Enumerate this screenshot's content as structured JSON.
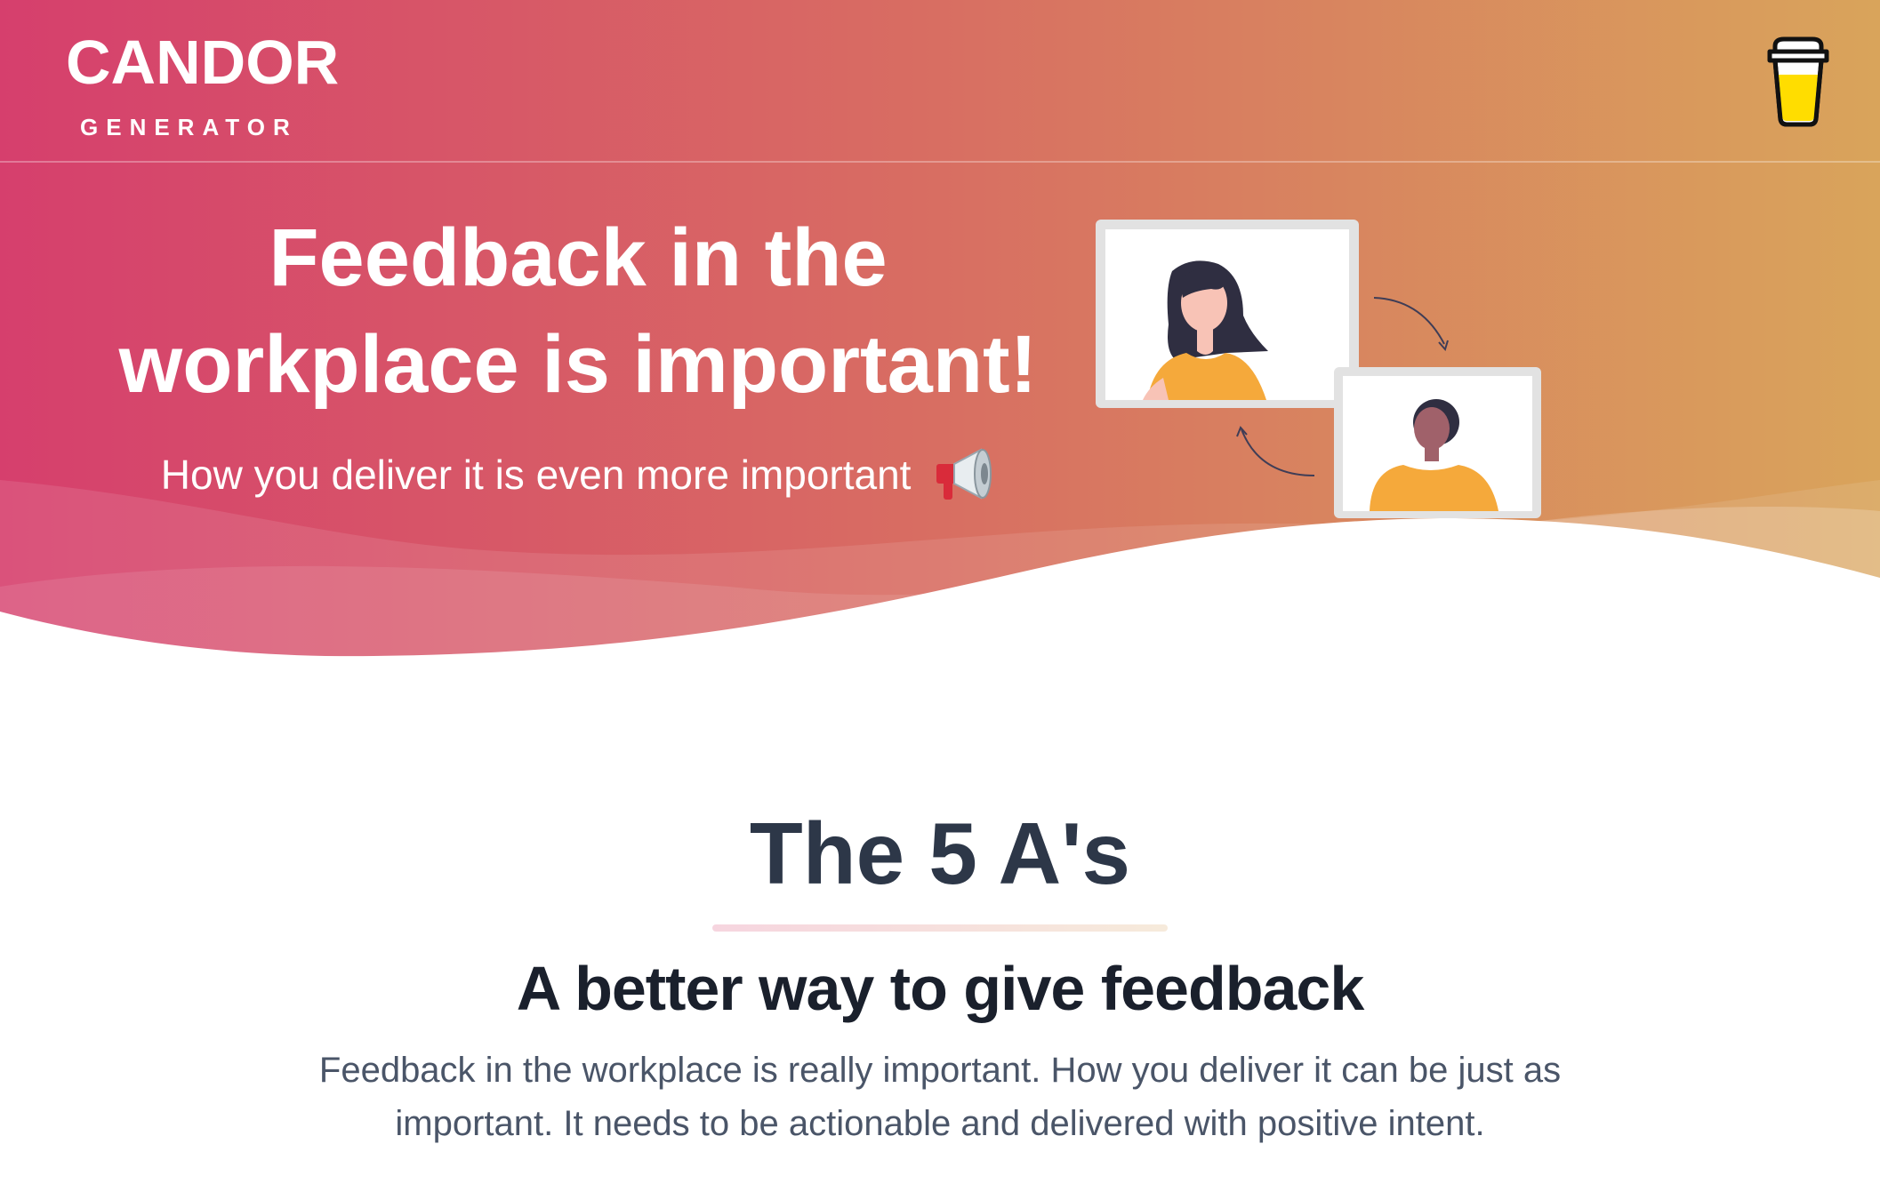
{
  "brand": {
    "title": "CANDOR",
    "subtitle": "GENERATOR"
  },
  "nav": {
    "coffee_icon": "coffee-cup-icon"
  },
  "hero": {
    "title": "Feedback in the workplace is important!",
    "subtitle": "How you deliver it is even more important",
    "emoji_icon": "megaphone-icon",
    "illustration": "video-call-feedback-illustration",
    "gradient_start": "#D6406E",
    "gradient_end": "#D8A35A"
  },
  "intro": {
    "title": "The 5 A's",
    "subtitle": "A better way to give feedback",
    "description": "Feedback in the workplace is really important. How you deliver it can be just as important. It needs to be actionable and delivered with positive intent."
  },
  "colors": {
    "heading": "#2d3748",
    "subheading": "#1a202c",
    "body_text": "#4a5568",
    "accent_orange": "#F5A93B"
  }
}
